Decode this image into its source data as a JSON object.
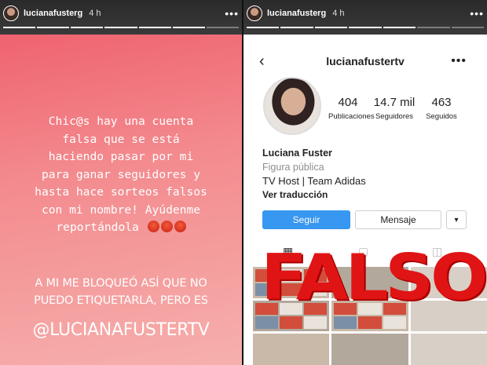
{
  "left_story": {
    "username": "lucianafusterg",
    "time": "4 h",
    "more": "•••",
    "message": "Chic@s hay una cuenta\nfalsa que se está\nhaciendo pasar por mi\npara ganar seguidores y\nhasta hace sorteos falsos\ncon mi nombre! Ayúdenme\nreportándola",
    "subtext": "A MI ME BLOQUEÓ ASÍ QUE NO\nPUEDO ETIQUETARLA, PERO ES",
    "mention": "@LUCIANAFUSTERTV"
  },
  "right_story": {
    "username": "lucianafusterg",
    "time": "4 h",
    "more": "•••"
  },
  "profile": {
    "back": "‹",
    "handle": "lucianafustertv",
    "more": "•••",
    "stats": [
      {
        "value": "404",
        "label": "Publicaciones"
      },
      {
        "value": "14.7 mil",
        "label": "Seguidores"
      },
      {
        "value": "463",
        "label": "Seguidos"
      }
    ],
    "name": "Luciana Fuster",
    "category": "Figura pública",
    "bio": "TV Host | Team Adidas",
    "translate": "Ver traducción",
    "follow_label": "Seguir",
    "message_label": "Mensaje",
    "dropdown": "▾",
    "stamp": "FALSO"
  },
  "colors": {
    "story_gradient_top": "#ee5a68",
    "story_gradient_bottom": "#f6b0ad",
    "follow_button": "#3897f0",
    "stamp": "#e01414"
  }
}
